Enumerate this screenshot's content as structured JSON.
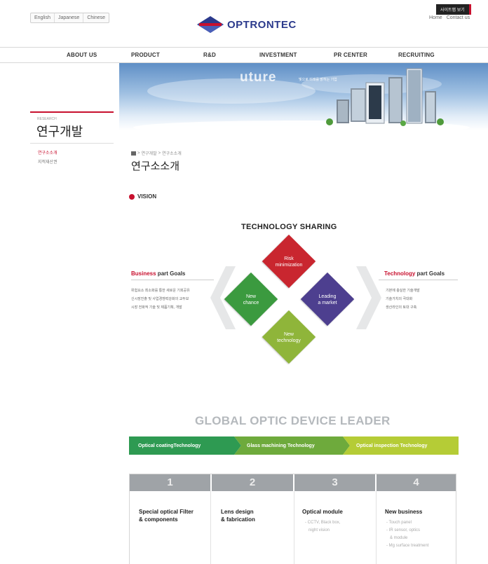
{
  "header": {
    "languages": [
      "English",
      "Japanese",
      "Chinese"
    ],
    "logo_text": "OPTRONTEC",
    "sitemap_label": "사이트맵 보기",
    "links": [
      "Home",
      "Contact us"
    ]
  },
  "nav": {
    "items": [
      "ABOUT US",
      "PRODUCT",
      "R&D",
      "INVESTMENT",
      "PR CENTER",
      "RECRUITING"
    ]
  },
  "banner": {
    "word_faded": "uture",
    "word_highlight": "e",
    "tagline": "빛으로 미래를 밝히는 기업"
  },
  "sidebar": {
    "eng_label": "RESEARCH",
    "title": "연구개발",
    "items": [
      {
        "label": "연구소소개",
        "active": true
      },
      {
        "label": "지적재산권",
        "active": false
      }
    ]
  },
  "breadcrumb": [
    "연구개발",
    "연구소소개"
  ],
  "page_title": "연구소소개",
  "vision_label": "VISION",
  "tech_sharing": {
    "title": "TECHNOLOGY SHARING",
    "business": {
      "head_red": "Business",
      "head_rest": " part Goals",
      "lines": [
        "위험요소 최소화를 통한 새로운 기회공유",
        "신시장진출 및 사업경쟁력강화의 교두보",
        "시장 전화적 기술 및 제품기획, 개발"
      ]
    },
    "technology": {
      "head_red": "Technology",
      "head_rest": " part Goals",
      "lines": [
        "기본에 충실한 기술개발",
        "기술가치의 극대화",
        "생산라인의 토대 구축"
      ]
    },
    "diamonds": [
      {
        "key": "risk",
        "lines": [
          "Risk",
          "minimization"
        ],
        "color": "#c9262f"
      },
      {
        "key": "chance",
        "lines": [
          "New",
          "chance"
        ],
        "color": "#3b9a3f"
      },
      {
        "key": "market",
        "lines": [
          "Leading",
          "a market"
        ],
        "color": "#4d3f8f"
      },
      {
        "key": "tech",
        "lines": [
          "New",
          "technology"
        ],
        "color": "#8fb53a"
      }
    ]
  },
  "global_leader": "GLOBAL OPTIC DEVICE LEADER",
  "ribbon": [
    {
      "label": "Optical coatingTechnology",
      "color": "#2e9a52"
    },
    {
      "label": "Glass machining Technology",
      "color": "#6eaa3c"
    },
    {
      "label": "Optical inspection Technology",
      "color": "#b5cc36"
    }
  ],
  "steps": [
    {
      "num": "1",
      "title": [
        "Special optical Filter",
        "& components"
      ],
      "subs": []
    },
    {
      "num": "2",
      "title": [
        "Lens design",
        "& fabrication"
      ],
      "subs": []
    },
    {
      "num": "3",
      "title": [
        "Optical module"
      ],
      "subs": [
        "- CCTV, Black box,",
        "night vision"
      ]
    },
    {
      "num": "4",
      "title": [
        "New business"
      ],
      "subs": [
        "- Touch panel",
        "- IR sensor, optics",
        "& module",
        "- Mg surface treatment"
      ]
    }
  ]
}
